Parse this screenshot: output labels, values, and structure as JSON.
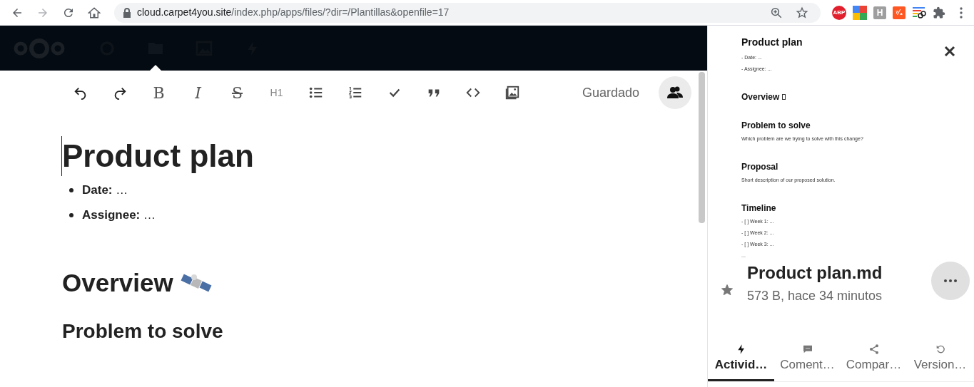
{
  "browser": {
    "url_host": "cloud.carpet4you.site",
    "url_path": "/index.php/apps/files/?dir=/Plantillas&openfile=17",
    "forward_disabled": true,
    "extensions": [
      {
        "kind": "abp",
        "label": "ABP"
      },
      {
        "kind": "google"
      },
      {
        "kind": "h",
        "label": "H"
      },
      {
        "kind": "orange",
        "label": "⁷⁄₄"
      },
      {
        "kind": "links"
      },
      {
        "kind": "puzzle"
      }
    ]
  },
  "header": {
    "apps": [
      {
        "kind": "dashboard",
        "selected": false
      },
      {
        "kind": "files",
        "selected": true
      },
      {
        "kind": "photos",
        "selected": false
      },
      {
        "kind": "activity",
        "selected": false
      }
    ]
  },
  "toolbar": {
    "buttons": [
      {
        "kind": "undo"
      },
      {
        "kind": "redo"
      },
      {
        "kind": "bold",
        "label": "B"
      },
      {
        "kind": "italic",
        "label": "I"
      },
      {
        "kind": "strike",
        "label": "S"
      },
      {
        "kind": "heading",
        "label": "H1"
      },
      {
        "kind": "bullets"
      },
      {
        "kind": "numbers"
      },
      {
        "kind": "check"
      },
      {
        "kind": "quote"
      },
      {
        "kind": "code"
      },
      {
        "kind": "image"
      }
    ],
    "status": "Guardado"
  },
  "document": [
    {
      "kind": "h1",
      "text": "Product plan"
    },
    {
      "kind": "bullets",
      "items": [
        "**Date:** …",
        "**Assignee:** …"
      ]
    },
    {
      "kind": "h2-emoji",
      "text": "Overview"
    },
    {
      "kind": "h2",
      "text": "Problem to solve"
    }
  ],
  "sidebar": {
    "preview": [
      {
        "kind": "h1",
        "text": "Product plan"
      },
      {
        "kind": "p",
        "text": "- Date: ..."
      },
      {
        "kind": "p",
        "text": "- Assignee: ..."
      },
      {
        "kind": "h2-glyph",
        "text": "Overview"
      },
      {
        "kind": "h2",
        "text": "Problem to solve"
      },
      {
        "kind": "p",
        "text": "Which problem are we trying to solve with this change?"
      },
      {
        "kind": "h2",
        "text": "Proposal"
      },
      {
        "kind": "p",
        "text": "Short description of our proposed solution."
      },
      {
        "kind": "h2",
        "text": "Timeline"
      },
      {
        "kind": "p",
        "text": "- [ ] Week 1: ..."
      },
      {
        "kind": "p",
        "text": "- [ ] Week 2: ..."
      },
      {
        "kind": "p",
        "text": "- [ ] Week 3: ..."
      },
      {
        "kind": "p",
        "text": "..."
      }
    ],
    "file_name": "Product plan.md",
    "favorite": true,
    "file_info": "573 B, hace 34 minutos",
    "tabs": [
      {
        "kind": "activity",
        "label": "Activid…",
        "selected": true
      },
      {
        "kind": "comments",
        "label": "Coment…",
        "selected": false
      },
      {
        "kind": "share",
        "label": "Compar…",
        "selected": false
      },
      {
        "kind": "versions",
        "label": "Version…",
        "selected": false
      }
    ]
  }
}
